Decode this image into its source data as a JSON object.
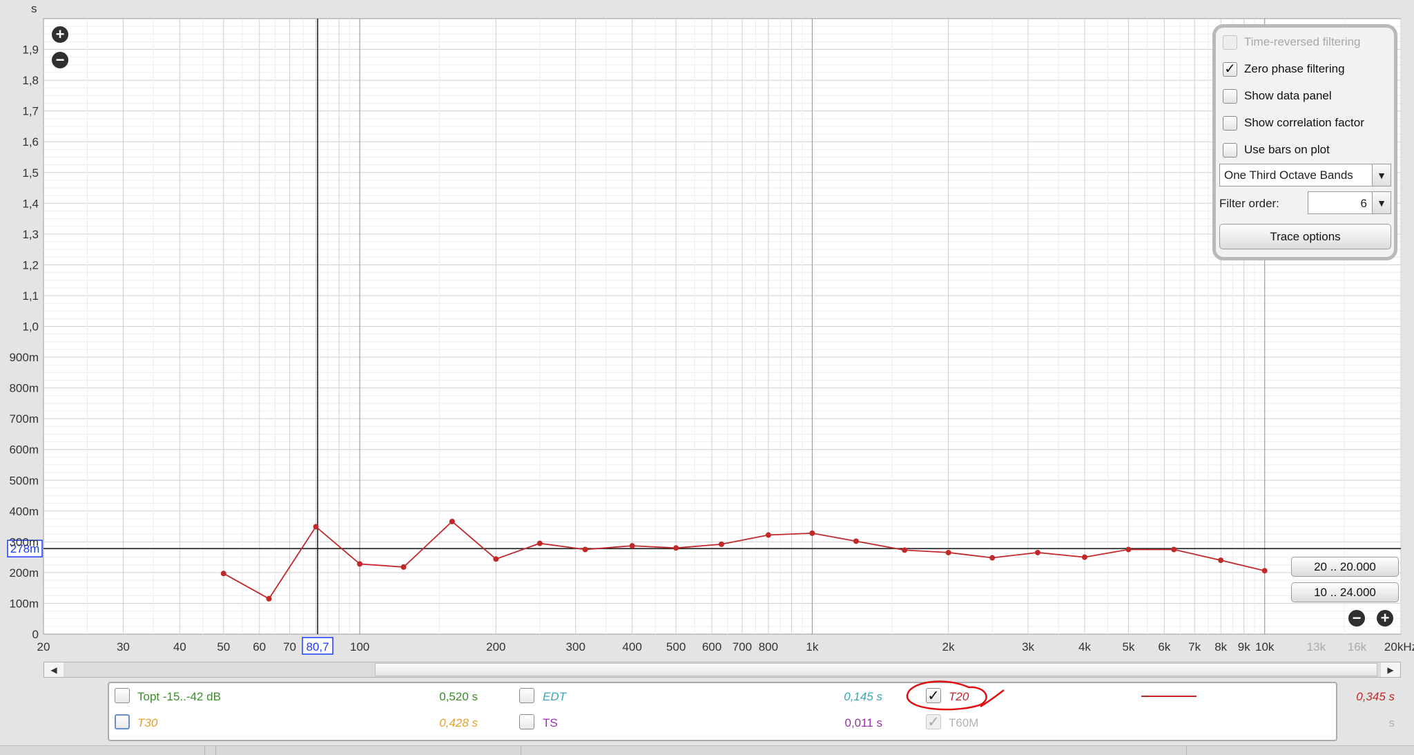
{
  "chart_data": {
    "type": "line",
    "y_unit": "s",
    "x_unit": "Hz",
    "x_scale": "log",
    "xlim": [
      20,
      20000
    ],
    "ylim": [
      0,
      2.0
    ],
    "grid": true,
    "y_ticks": [
      {
        "v": 0,
        "label": "0"
      },
      {
        "v": 0.1,
        "label": "100m"
      },
      {
        "v": 0.2,
        "label": "200m"
      },
      {
        "v": 0.3,
        "label": "300m"
      },
      {
        "v": 0.4,
        "label": "400m"
      },
      {
        "v": 0.5,
        "label": "500m"
      },
      {
        "v": 0.6,
        "label": "600m"
      },
      {
        "v": 0.7,
        "label": "700m"
      },
      {
        "v": 0.8,
        "label": "800m"
      },
      {
        "v": 0.9,
        "label": "900m"
      },
      {
        "v": 1.0,
        "label": "1,0"
      },
      {
        "v": 1.1,
        "label": "1,1"
      },
      {
        "v": 1.2,
        "label": "1,2"
      },
      {
        "v": 1.3,
        "label": "1,3"
      },
      {
        "v": 1.4,
        "label": "1,4"
      },
      {
        "v": 1.5,
        "label": "1,5"
      },
      {
        "v": 1.6,
        "label": "1,6"
      },
      {
        "v": 1.7,
        "label": "1,7"
      },
      {
        "v": 1.8,
        "label": "1,8"
      },
      {
        "v": 1.9,
        "label": "1,9"
      }
    ],
    "x_ticks": [
      {
        "v": 20,
        "label": "20"
      },
      {
        "v": 30,
        "label": "30"
      },
      {
        "v": 40,
        "label": "40"
      },
      {
        "v": 50,
        "label": "50"
      },
      {
        "v": 60,
        "label": "60"
      },
      {
        "v": 70,
        "label": "70"
      },
      {
        "v": 100,
        "label": "100"
      },
      {
        "v": 200,
        "label": "200"
      },
      {
        "v": 300,
        "label": "300"
      },
      {
        "v": 400,
        "label": "400"
      },
      {
        "v": 500,
        "label": "500"
      },
      {
        "v": 600,
        "label": "600"
      },
      {
        "v": 700,
        "label": "700"
      },
      {
        "v": 800,
        "label": "800"
      },
      {
        "v": 1000,
        "label": "1k"
      },
      {
        "v": 2000,
        "label": "2k"
      },
      {
        "v": 3000,
        "label": "3k"
      },
      {
        "v": 4000,
        "label": "4k"
      },
      {
        "v": 5000,
        "label": "5k"
      },
      {
        "v": 6000,
        "label": "6k"
      },
      {
        "v": 7000,
        "label": "7k"
      },
      {
        "v": 8000,
        "label": "8k"
      },
      {
        "v": 9000,
        "label": "9k"
      },
      {
        "v": 10000,
        "label": "10k"
      },
      {
        "v": 13000,
        "label": "13k",
        "dim": true
      },
      {
        "v": 16000,
        "label": "16k",
        "dim": true
      },
      {
        "v": 20000,
        "label": "20kHz"
      }
    ],
    "cursor": {
      "x": 80.7,
      "x_label": "80,7",
      "y": 0.278,
      "y_label": "278m"
    },
    "series": [
      {
        "name": "T20",
        "color": "#c0282a",
        "x": [
          50,
          63,
          80,
          100,
          125,
          160,
          200,
          250,
          315,
          400,
          500,
          630,
          800,
          1000,
          1250,
          1600,
          2000,
          2500,
          3150,
          4000,
          5000,
          6300,
          8000,
          10000
        ],
        "y": [
          0.197,
          0.115,
          0.349,
          0.228,
          0.218,
          0.366,
          0.244,
          0.295,
          0.275,
          0.287,
          0.28,
          0.292,
          0.322,
          0.328,
          0.302,
          0.273,
          0.265,
          0.248,
          0.265,
          0.25,
          0.275,
          0.275,
          0.24,
          0.206
        ]
      }
    ]
  },
  "ui": {
    "panel": {
      "time_reversed": "Time-reversed filtering",
      "zero_phase": "Zero phase filtering",
      "zero_phase_check": "✓",
      "show_data_panel": "Show data panel",
      "show_correlation": "Show correlation factor",
      "use_bars": "Use bars on plot",
      "band_select": "One Third Octave Bands",
      "filter_order_label": "Filter order:",
      "filter_order_value": "6",
      "trace_options": "Trace options"
    },
    "range_buttons": [
      "20 .. 20.000",
      "10 .. 24.000"
    ],
    "zoom": {
      "in": "+",
      "out": "−"
    },
    "scroll": {
      "left": "◀",
      "right": "▶"
    },
    "legend": {
      "topt_name": "Topt -15..-42 dB",
      "topt_value": "0,520 s",
      "topt_color": "#3c8c2c",
      "t30_name": "T30",
      "t30_value": "0,428 s",
      "t30_color": "#e0a030",
      "edt_name": "EDT",
      "edt_value": "0,145 s",
      "edt_color": "#3aa6b4",
      "ts_name": "TS",
      "ts_value": "0,011 s",
      "ts_color": "#9b2fb0",
      "t20_name": "T20",
      "t20_value": "0,345 s",
      "t20_check": "✓",
      "t20_color": "#c0282a",
      "t60m_name": "T60M",
      "t60m_value": "s",
      "t60m_check": "✓"
    }
  }
}
